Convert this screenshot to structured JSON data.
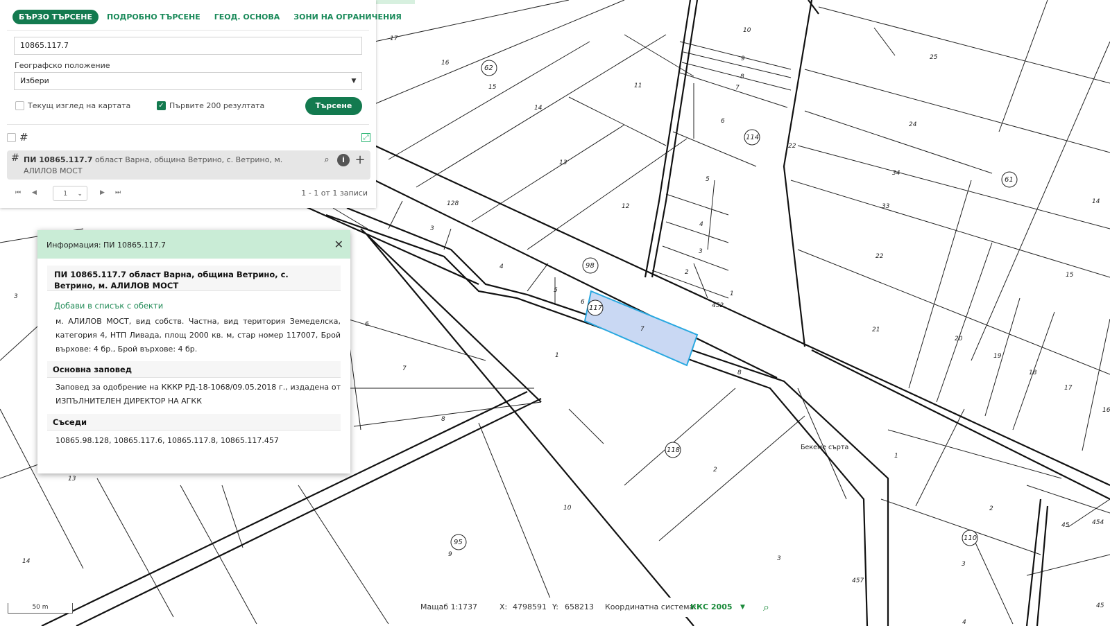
{
  "search": {
    "tabs": [
      "БЪРЗО ТЪРСЕНЕ",
      "ПОДРОБНО ТЪРСЕНЕ",
      "ГЕОД. ОСНОВА",
      "ЗОНИ НА ОГРАНИЧЕНИЯ"
    ],
    "query_value": "10865.117.7",
    "geo_label": "Географско положение",
    "geo_value": "Избери",
    "opt_current_view": "Текущ изглед на картата",
    "opt_first_200": "Първите 200 резултата",
    "search_button": "Търсене"
  },
  "result": {
    "id": "ПИ 10865.117.7",
    "location": "област Варна, община Ветрино, с. Ветрино, м.",
    "locality": "АЛИЛОВ МОСТ"
  },
  "pager": {
    "page": "1",
    "info": "1 - 1 от 1 записи"
  },
  "popup": {
    "title": "Информация: ПИ 10865.117.7",
    "heading": "ПИ 10865.117.7 област Варна, община Ветрино, с. Ветрино, м. АЛИЛОВ МОСТ",
    "add_link": "Добави в списък с обекти",
    "description": "м. АЛИЛОВ МОСТ, вид собств. Частна, вид територия Земеделска, категория 4, НТП Ливада, площ 2000 кв. м, стар номер 117007, Брой върхове: 4 бр., Брой върхове: 4 бр.",
    "order_heading": "Основна заповед",
    "order_text": "Заповед за одобрение на КККР РД-18-1068/09.05.2018 г., издадена от ИЗПЪЛНИТЕЛЕН ДИРЕКТОР НА АГКК",
    "neighbors_heading": "Съседи",
    "neighbors": "10865.98.128, 10865.117.6, 10865.117.8, 10865.117.457"
  },
  "status": {
    "scale_label": "Мащаб 1:",
    "scale_value": "1737",
    "x_label": "X:",
    "x_value": "4798591",
    "y_label": "Y:",
    "y_value": "658213",
    "crs_label": "Координатна система:",
    "crs_value": "ККС 2005",
    "scalebar": "50 m"
  },
  "map": {
    "parcel_labels": [
      "17",
      "16",
      "15",
      "14",
      "13",
      "12",
      "11",
      "10",
      "9",
      "8",
      "7",
      "6",
      "5",
      "4",
      "3",
      "2",
      "1",
      "25",
      "24",
      "34",
      "33",
      "22",
      "21",
      "20",
      "19",
      "18",
      "17",
      "15",
      "14",
      "16",
      "22",
      "128",
      "3",
      "4",
      "5",
      "6",
      "7",
      "1",
      "6",
      "7",
      "8",
      "8",
      "452",
      "2",
      "10",
      "3",
      "13",
      "14",
      "9",
      "1",
      "2",
      "3",
      "4",
      "45",
      "454",
      "457",
      "45",
      "3",
      "1",
      "16"
    ],
    "circle_labels": [
      "62",
      "114",
      "61",
      "98",
      "117",
      "118",
      "95",
      "110"
    ],
    "place_name": "Бекеме сърта",
    "highlight_fill": "#c9d8f3",
    "highlight_stroke": "#29a8e0"
  }
}
